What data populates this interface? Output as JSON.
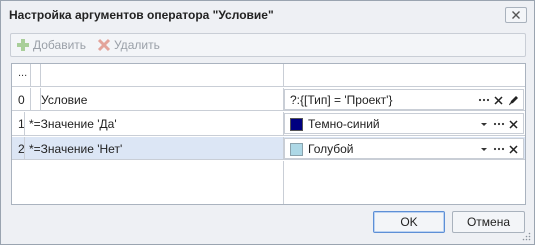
{
  "window": {
    "title": "Настройка аргументов оператора \"Условие\""
  },
  "toolbar": {
    "add_label": "Добавить",
    "delete_label": "Удалить"
  },
  "grid": {
    "header_dots": "...",
    "rows": [
      {
        "index": "0",
        "name": "Условие",
        "value": "?:{[Тип] = 'Проект'}"
      },
      {
        "index": "1",
        "name": "*=Значение 'Да'",
        "value": "Темно-синий",
        "color": "#000080"
      },
      {
        "index": "2",
        "name": "*=Значение 'Нет'",
        "value": "Голубой",
        "color": "#add8e6"
      }
    ]
  },
  "buttons": {
    "ok_label": "OK",
    "cancel_label": "Отмена"
  },
  "colors": {
    "selected_row": "#dce6f5",
    "window_bg": "#eef0f4"
  }
}
